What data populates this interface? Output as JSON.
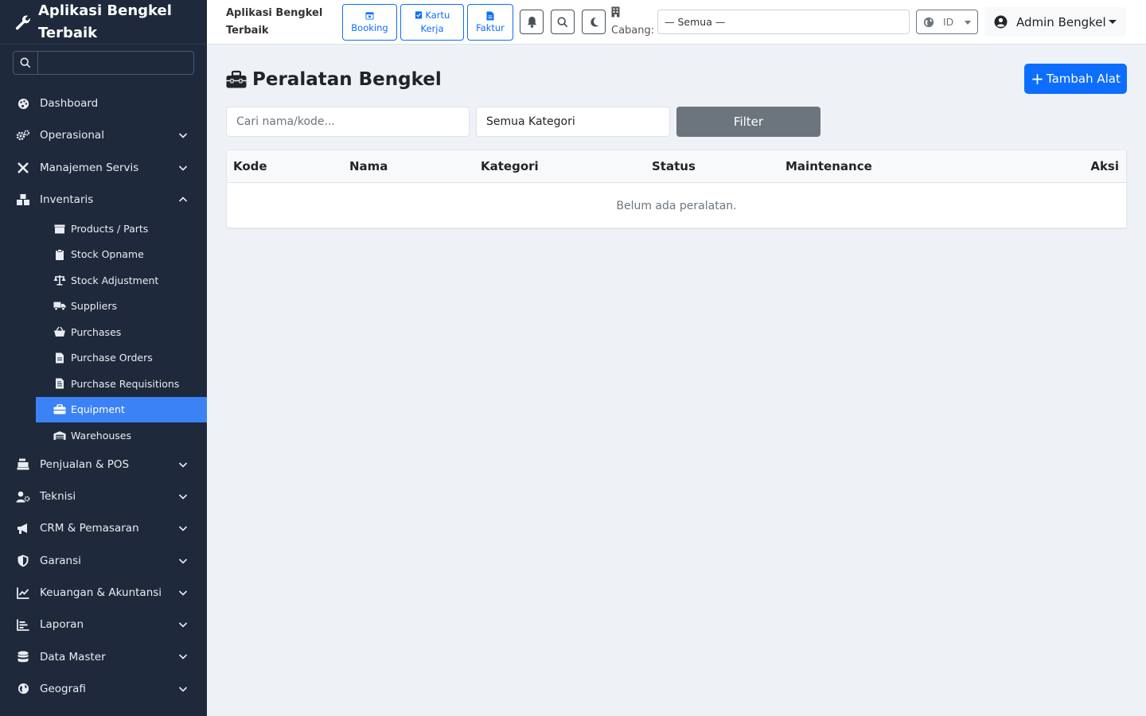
{
  "app": {
    "title": "Aplikasi Bengkel Terbaik",
    "brand_color": "#1e293b",
    "accent_color": "#3b82f6",
    "primary_color": "#0d6efd"
  },
  "sidebar": {
    "search_placeholder": "",
    "items": [
      {
        "label": "Dashboard",
        "icon": "palette-icon"
      },
      {
        "label": "Operasional",
        "icon": "cogs-icon"
      },
      {
        "label": "Manajemen Servis",
        "icon": "tools-icon"
      },
      {
        "label": "Inventaris",
        "icon": "boxes-icon"
      }
    ],
    "inventaris_sub": [
      {
        "label": "Products / Parts",
        "icon": "box-icon"
      },
      {
        "label": "Stock Opname",
        "icon": "clipboard-icon"
      },
      {
        "label": "Stock Adjustment",
        "icon": "scale-icon"
      },
      {
        "label": "Suppliers",
        "icon": "truck-icon"
      },
      {
        "label": "Purchases",
        "icon": "basket-icon"
      },
      {
        "label": "Purchase Orders",
        "icon": "file-invoice-icon"
      },
      {
        "label": "Purchase Requisitions",
        "icon": "file-list-icon"
      },
      {
        "label": "Equipment",
        "icon": "toolbox-icon",
        "active": true
      },
      {
        "label": "Warehouses",
        "icon": "warehouse-icon"
      }
    ],
    "items_after": [
      {
        "label": "Penjualan & POS",
        "icon": "cash-register-icon"
      },
      {
        "label": "Teknisi",
        "icon": "user-gear-icon"
      },
      {
        "label": "CRM & Pemasaran",
        "icon": "bullhorn-icon"
      },
      {
        "label": "Garansi",
        "icon": "shield-icon"
      },
      {
        "label": "Keuangan & Akuntansi",
        "icon": "line-chart-icon"
      },
      {
        "label": "Laporan",
        "icon": "bar-chart-icon"
      },
      {
        "label": "Data Master",
        "icon": "database-icon"
      },
      {
        "label": "Geografi",
        "icon": "globe-icon"
      }
    ]
  },
  "topbar": {
    "brand": "Aplikasi Bengkel Terbaik",
    "quick_buttons": [
      {
        "label": "Booking",
        "icon": "calendar-icon"
      },
      {
        "label": "Kartu Kerja",
        "icon": "clipboard-check-icon"
      },
      {
        "label": "Faktur",
        "icon": "file-icon"
      }
    ],
    "cabang_label": "Cabang:",
    "cabang_value": "— Semua —",
    "lang": "ID",
    "user": "Admin Bengkel"
  },
  "main": {
    "title": "Peralatan Bengkel",
    "add_button": "Tambah Alat",
    "search_placeholder": "Cari nama/kode...",
    "category_value": "Semua Kategori",
    "filter_button": "Filter",
    "table": {
      "columns": [
        "Kode",
        "Nama",
        "Kategori",
        "Status",
        "Maintenance",
        "Aksi"
      ],
      "empty_message": "Belum ada peralatan."
    }
  }
}
